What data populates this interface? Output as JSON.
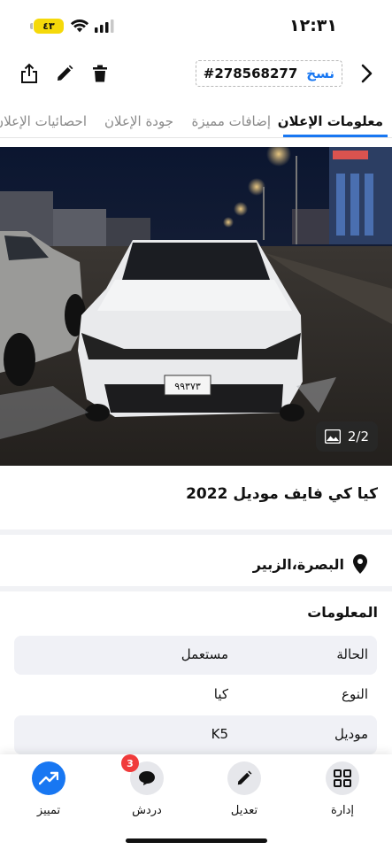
{
  "status_bar": {
    "time": "١٢:٣١",
    "battery_level": "٤٣"
  },
  "header": {
    "copy_label": "نسخ",
    "ad_id": "#278568277",
    "icons": [
      "share-icon",
      "pencil-icon",
      "trash-icon",
      "chevron-right-icon"
    ]
  },
  "tabs": [
    {
      "label": "معلومات الإعلان",
      "active": true
    },
    {
      "label": "إضافات مميزة",
      "active": false
    },
    {
      "label": "جودة الإعلان",
      "active": false
    },
    {
      "label": "احصائيات الإعلان",
      "active": false
    }
  ],
  "photo": {
    "counter": "2/2",
    "plate_number": "٩٩٣٧٣"
  },
  "listing": {
    "title": "كيا كي فايف  موديل 2022",
    "location": "البصرة،الزبير"
  },
  "info": {
    "section_title": "المعلومات",
    "rows": [
      {
        "label": "الحالة",
        "value": "مستعمل"
      },
      {
        "label": "النوع",
        "value": "كيا"
      },
      {
        "label": "موديل",
        "value": "K5"
      }
    ]
  },
  "bottom_nav": {
    "items": [
      {
        "label": "إدارة",
        "icon": "grid-icon"
      },
      {
        "label": "تعديل",
        "icon": "pencil-icon"
      },
      {
        "label": "دردش",
        "icon": "chat-icon",
        "badge": "3"
      },
      {
        "label": "تمييز",
        "icon": "trending-up-icon"
      }
    ]
  },
  "colors": {
    "accent": "#1877f2",
    "badge": "#f03b3b",
    "battery": "#f5d90a"
  }
}
